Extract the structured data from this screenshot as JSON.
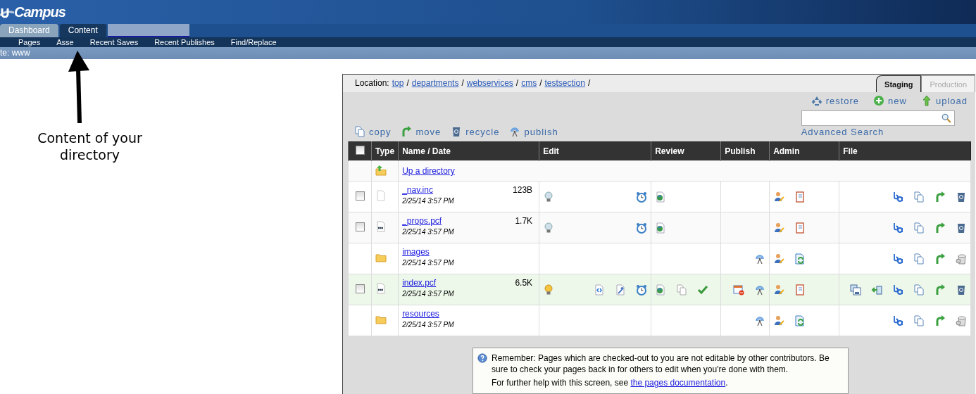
{
  "logo": {
    "text": "Campus"
  },
  "tabs": [
    {
      "label": "Dashboard",
      "selected": false
    },
    {
      "label": "Content",
      "selected": true
    }
  ],
  "subnav": [
    "Pages",
    "Asse",
    "Recent Saves",
    "Recent Publishes",
    "Find/Replace"
  ],
  "site_bar": {
    "text": "te: www"
  },
  "annotation": {
    "text": "Content of your directory"
  },
  "location": {
    "label": "Location:",
    "crumbs": [
      {
        "label": "top",
        "separator": "/"
      },
      {
        "label": "departments",
        "separator": "/"
      },
      {
        "label": "webservices",
        "separator": "/"
      },
      {
        "label": "cms",
        "separator": "/"
      },
      {
        "label": "testsection",
        "separator": "/"
      }
    ]
  },
  "server_tabs": [
    {
      "label": "Staging",
      "selected": true
    },
    {
      "label": "Production",
      "selected": false
    }
  ],
  "top_actions": [
    {
      "kind": "restore",
      "label": "restore"
    },
    {
      "kind": "new",
      "label": "new"
    },
    {
      "kind": "upload",
      "label": "upload"
    }
  ],
  "search": {
    "link": "Advanced Search"
  },
  "bulk_actions": [
    {
      "kind": "copy",
      "label": "copy"
    },
    {
      "kind": "move",
      "label": "move"
    },
    {
      "kind": "recycle",
      "label": "recycle"
    },
    {
      "kind": "publish",
      "label": "publish"
    }
  ],
  "table": {
    "header_checked": false,
    "columns": [
      "Type",
      "Name / Date",
      "Edit",
      "Review",
      "Publish",
      "Admin",
      "File"
    ],
    "up_link": "Up a directory",
    "rows": [
      {
        "kind": "file",
        "name": "_nav.inc",
        "date": "2/25/14 3:57 PM",
        "size": "123B",
        "checked": false,
        "selected": false,
        "edit": [
          {
            "kind": "bulb",
            "lit": false
          },
          {
            "kind": "clock"
          }
        ],
        "review": [
          {
            "kind": "globe"
          }
        ],
        "publish": [],
        "admin": [
          {
            "kind": "person"
          },
          {
            "kind": "notebook"
          }
        ],
        "file": [
          {
            "kind": "rename"
          },
          {
            "kind": "copy"
          },
          {
            "kind": "move"
          },
          {
            "kind": "recycle"
          }
        ]
      },
      {
        "kind": "pcf",
        "name": "_props.pcf",
        "date": "2/25/14 3:57 PM",
        "size": "1.7K",
        "checked": false,
        "selected": false,
        "edit": [
          {
            "kind": "bulb",
            "lit": false
          },
          {
            "kind": "clock"
          }
        ],
        "review": [
          {
            "kind": "globe"
          }
        ],
        "publish": [],
        "admin": [
          {
            "kind": "person"
          },
          {
            "kind": "notebook"
          }
        ],
        "file": [
          {
            "kind": "rename"
          },
          {
            "kind": "copy"
          },
          {
            "kind": "move"
          },
          {
            "kind": "recycle"
          }
        ]
      },
      {
        "kind": "folder",
        "name": "images",
        "date": "2/25/14 3:57 PM",
        "selected": false,
        "edit": [],
        "review": [],
        "publish": [
          {
            "kind": "antenna"
          }
        ],
        "admin": [
          {
            "kind": "person"
          },
          {
            "kind": "sync"
          }
        ],
        "file": [
          {
            "kind": "rename"
          },
          {
            "kind": "copy"
          },
          {
            "kind": "move"
          },
          {
            "kind": "trash"
          }
        ]
      },
      {
        "kind": "pcf",
        "name": "index.pcf",
        "date": "2/25/14 3:57 PM",
        "size": "6.5K",
        "checked": false,
        "selected": true,
        "edit": [
          {
            "kind": "bulb",
            "lit": true
          },
          {
            "kind": "source"
          },
          {
            "kind": "wrench"
          },
          {
            "kind": "clock"
          }
        ],
        "review": [
          {
            "kind": "globe"
          },
          {
            "kind": "pages"
          },
          {
            "kind": "check"
          }
        ],
        "publish": [
          {
            "kind": "calendar"
          },
          {
            "kind": "antenna"
          }
        ],
        "admin": [
          {
            "kind": "person"
          },
          {
            "kind": "notebook"
          }
        ],
        "file": [
          {
            "kind": "stack"
          },
          {
            "kind": "export"
          },
          {
            "kind": "rename"
          },
          {
            "kind": "copy"
          },
          {
            "kind": "move"
          },
          {
            "kind": "recycle"
          }
        ]
      },
      {
        "kind": "folder",
        "name": "resources",
        "date": "2/25/14 3:57 PM",
        "selected": false,
        "edit": [],
        "review": [],
        "publish": [
          {
            "kind": "antenna"
          }
        ],
        "admin": [
          {
            "kind": "person"
          },
          {
            "kind": "sync"
          }
        ],
        "file": [
          {
            "kind": "rename"
          },
          {
            "kind": "copy"
          },
          {
            "kind": "move"
          },
          {
            "kind": "trash"
          }
        ]
      }
    ]
  },
  "notice": {
    "text": "Remember: Pages which are checked-out to you are not editable by other contributors. Be sure to check your pages back in for others to edit when you're done with them.",
    "help_prefix": "For further help with this screen, see ",
    "help_link": "the pages documentation",
    "help_suffix": "."
  }
}
